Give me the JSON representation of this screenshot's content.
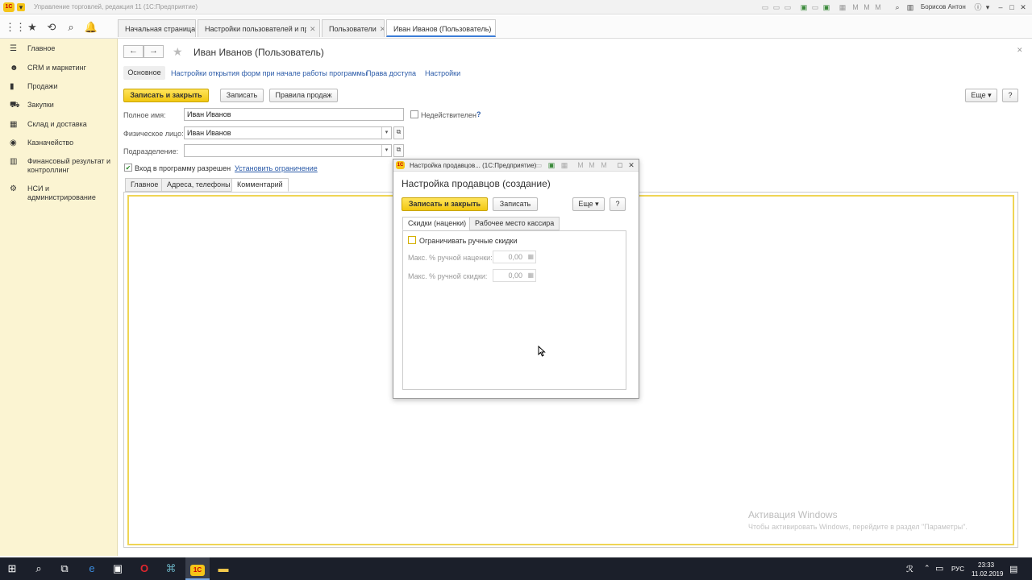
{
  "window": {
    "title": "Управление торговлей, редакция 11  (1С:Предприятие)",
    "user": "Борисов Антон"
  },
  "tabs": [
    {
      "label": "Начальная страница"
    },
    {
      "label": "Настройки пользователей и прав"
    },
    {
      "label": "Пользователи"
    },
    {
      "label": "Иван Иванов (Пользователь)"
    }
  ],
  "sidebar": {
    "items": [
      {
        "label": "Главное",
        "icon": "menu-icon"
      },
      {
        "label": "CRM и маркетинг",
        "icon": "crm-icon"
      },
      {
        "label": "Продажи",
        "icon": "sales-icon"
      },
      {
        "label": "Закупки",
        "icon": "cart-icon"
      },
      {
        "label": "Склад и доставка",
        "icon": "warehouse-icon"
      },
      {
        "label": "Казначейство",
        "icon": "treasury-icon"
      },
      {
        "label": "Финансовый результат и контроллинг",
        "icon": "finance-icon"
      },
      {
        "label": "НСИ и администрирование",
        "icon": "gear-icon"
      }
    ]
  },
  "form": {
    "title": "Иван Иванов (Пользователь)",
    "nav": {
      "main": "Основное",
      "forms": "Настройки открытия форм при начале работы программы",
      "access": "Права доступа",
      "settings": "Настройки"
    },
    "buttons": {
      "save_close": "Записать и закрыть",
      "save": "Записать",
      "sales_rules": "Правила продаж",
      "more": "Еще",
      "help": "?"
    },
    "fields": {
      "full_name_label": "Полное имя:",
      "full_name": "Иван Иванов",
      "invalid_label": "Недействителен",
      "invalid_help": "?",
      "person_label": "Физическое лицо:",
      "person": "Иван Иванов",
      "dept_label": "Подразделение:",
      "dept": "",
      "login_allowed": "Вход в программу разрешен",
      "set_limit": "Установить ограничение"
    },
    "subtabs": [
      "Главное",
      "Адреса, телефоны",
      "Комментарий"
    ]
  },
  "dialog": {
    "window_title": "Настройка продавцов... (1С:Предприятие)",
    "title": "Настройка продавцов (создание)",
    "buttons": {
      "save_close": "Записать и закрыть",
      "save": "Записать",
      "more": "Еще",
      "help": "?"
    },
    "tabs": [
      "Скидки (наценки)",
      "Рабочее место кассира"
    ],
    "limit_manual": "Ограничивать ручные скидки",
    "max_markup_label": "Макс. % ручной наценки:",
    "max_markup": "0,00",
    "max_discount_label": "Макс. % ручной скидки:",
    "max_discount": "0,00"
  },
  "watermark": {
    "line1": "Активация Windows",
    "line2": "Чтобы активировать Windows, перейдите в раздел \"Параметры\"."
  },
  "taskbar": {
    "lang": "РУС",
    "time": "23:33",
    "date": "11.02.2019"
  }
}
